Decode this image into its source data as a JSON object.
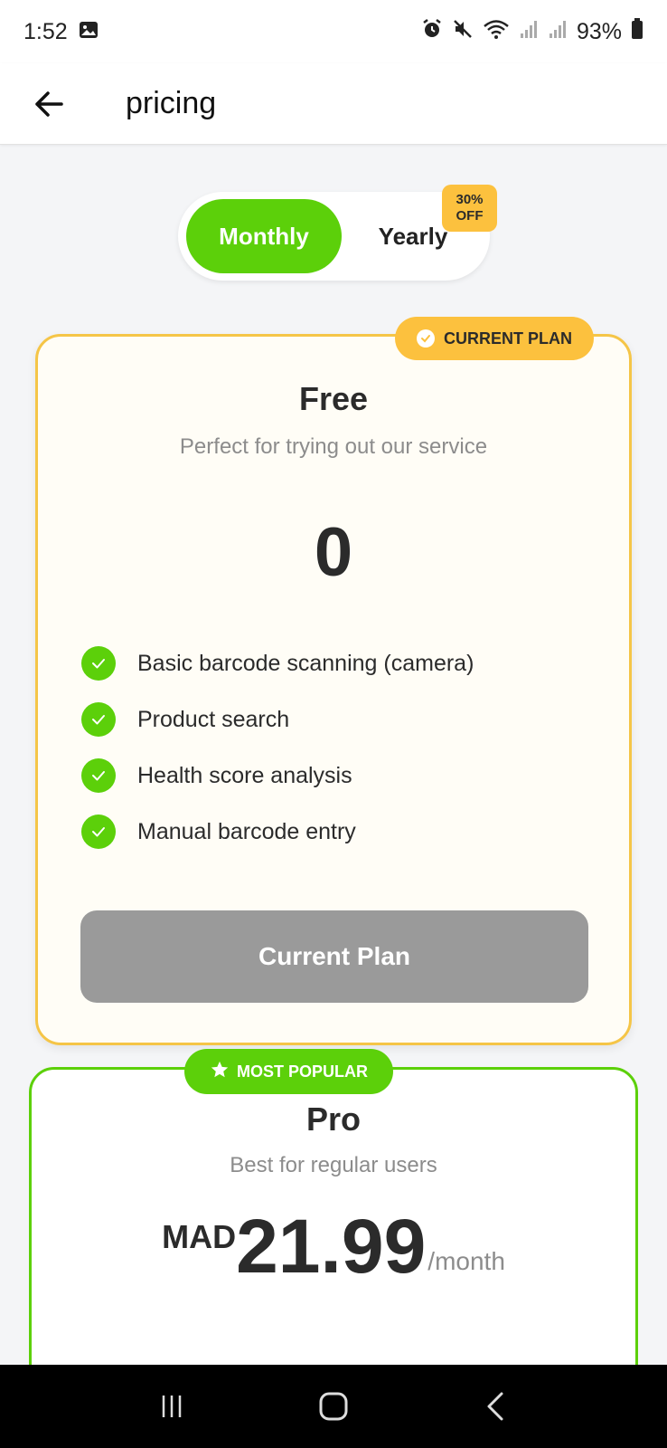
{
  "status_bar": {
    "time": "1:52",
    "battery": "93%",
    "icons": [
      "gallery-icon",
      "alarm-icon",
      "mute-icon",
      "wifi-icon",
      "signal-icon",
      "signal-icon",
      "battery-icon"
    ]
  },
  "header": {
    "title": "pricing",
    "back_icon": "arrow-left-icon"
  },
  "billing_toggle": {
    "monthly_label": "Monthly",
    "yearly_label": "Yearly",
    "selected": "Monthly",
    "discount_line1": "30%",
    "discount_line2": "OFF"
  },
  "plans": [
    {
      "badge": "CURRENT PLAN",
      "name": "Free",
      "description": "Perfect for trying out our service",
      "price": "0",
      "features": [
        "Basic barcode scanning (camera)",
        "Product search",
        "Health score analysis",
        "Manual barcode entry"
      ],
      "button_label": "Current Plan"
    },
    {
      "badge": "MOST POPULAR",
      "name": "Pro",
      "description": "Best for regular users",
      "currency": "MAD",
      "price": "21.99",
      "period": "/month"
    }
  ],
  "colors": {
    "accent_green": "#5cd00a",
    "accent_yellow": "#fcc13e",
    "disabled_gray": "#9a9a9a",
    "background": "#f4f5f7"
  }
}
